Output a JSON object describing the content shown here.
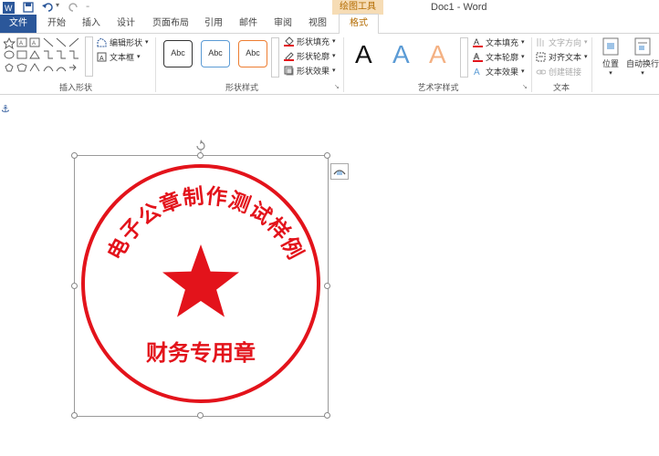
{
  "window": {
    "title": "Doc1 - Word",
    "context_label": "绘图工具"
  },
  "tabs": [
    {
      "label": "文件"
    },
    {
      "label": "开始"
    },
    {
      "label": "插入"
    },
    {
      "label": "设计"
    },
    {
      "label": "页面布局"
    },
    {
      "label": "引用"
    },
    {
      "label": "邮件"
    },
    {
      "label": "审阅"
    },
    {
      "label": "视图"
    },
    {
      "label": "格式"
    }
  ],
  "ribbon": {
    "insert_shapes": {
      "edit_shape": "编辑形状",
      "text_box": "文本框",
      "label": "插入形状"
    },
    "shape_styles": {
      "presets": [
        "Abc",
        "Abc",
        "Abc"
      ],
      "fill": "形状填充",
      "outline": "形状轮廓",
      "effects": "形状效果",
      "label": "形状样式"
    },
    "wordart": {
      "presets": [
        "A",
        "A",
        "A"
      ],
      "text_fill": "文本填充",
      "text_outline": "文本轮廓",
      "text_effects": "文本效果",
      "label": "艺术字样式"
    },
    "text": {
      "direction": "文字方向",
      "align": "对齐文本",
      "link": "创建链接",
      "label": "文本"
    },
    "arrange": {
      "position": "位置",
      "wrap": "自动换行"
    }
  },
  "seal": {
    "arc_text": "电子公章制作测试样例",
    "bottom_text": "财务专用章",
    "color": "#e3131b"
  },
  "colors": {
    "file_tab": "#2b579a",
    "context_tab": "#f6dcb5",
    "context_text": "#b36b00"
  }
}
